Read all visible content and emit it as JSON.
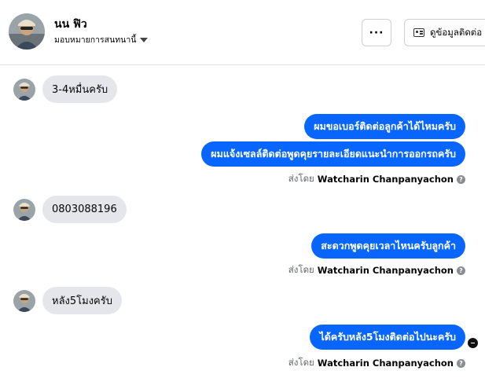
{
  "header": {
    "name": "นน ฟิว",
    "assign_label": "มอบหมายการสนทนานี้",
    "contact_button": "ดูข้อมูลติดต่อ",
    "more_button": "···"
  },
  "messages": [
    {
      "direction": "in",
      "text": "3-4หมื่นครับ"
    },
    {
      "direction": "out",
      "text": "ผมขอเบอร์ติดต่อลูกค้าได้ไหมครับ"
    },
    {
      "direction": "out",
      "text": "ผมแจ้งเซลล์ติดต่อพูดคุยรายละเอียดแนะนำการออกรถครับ"
    },
    {
      "direction": "in",
      "text": "0803088196"
    },
    {
      "direction": "out",
      "text": "สะดวกพูดคุยเวลาไหนครับลูกค้า"
    },
    {
      "direction": "in",
      "text": "หลัง5โมงครับ"
    },
    {
      "direction": "out",
      "text": "ได้ครับหลัง5โมงติดต่อไปนะครับ"
    }
  ],
  "sent_by": {
    "prefix": "ส่งโดย",
    "agent": "Watcharin Chanpanyachon",
    "help_glyph": "?"
  },
  "icons": {
    "contact": "contact-card-icon",
    "assign": "caret-down-icon",
    "seen": "seen-indicator-icon"
  },
  "colors": {
    "outgoing_bubble": "#0866ff",
    "incoming_bubble": "#e4e6eb"
  }
}
